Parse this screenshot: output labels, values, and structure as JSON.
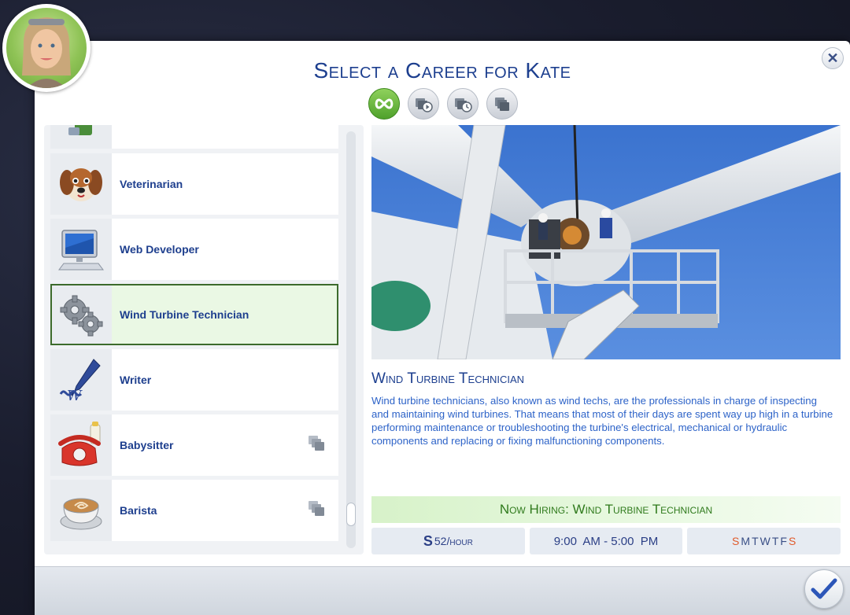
{
  "dialog": {
    "title": "Select a Career for Kate",
    "close_icon": "close-icon",
    "confirm_icon": "checkmark-icon"
  },
  "filters": [
    {
      "name": "all-careers",
      "icon": "infinity-icon",
      "active": true
    },
    {
      "name": "active-careers",
      "icon": "pack-play-icon",
      "active": false
    },
    {
      "name": "part-time-careers",
      "icon": "pack-clock-icon",
      "active": false
    },
    {
      "name": "pack-careers",
      "icon": "pack-icon",
      "active": false
    }
  ],
  "careers": [
    {
      "label": "",
      "icon": "career-icon-partial"
    },
    {
      "label": "Veterinarian",
      "icon": "dog-icon"
    },
    {
      "label": "Web Developer",
      "icon": "computer-icon"
    },
    {
      "label": "Wind Turbine Technician",
      "icon": "gears-icon",
      "selected": true
    },
    {
      "label": "Writer",
      "icon": "quill-pen-icon"
    },
    {
      "label": "Babysitter",
      "icon": "toy-phone-icon",
      "pack": true
    },
    {
      "label": "Barista",
      "icon": "latte-icon",
      "pack": true
    }
  ],
  "detail": {
    "title": "Wind Turbine Technician",
    "description": "Wind turbine technicians, also known as wind techs, are the professionals in charge of inspecting and maintaining wind turbines. That means that most of their days are spent way up high in a turbine performing maintenance or troubleshooting the turbine's electrical, mechanical or hydraulic components and replacing or fixing malfunctioning components.",
    "hiring": "Now Hiring: Wind Turbine Technician",
    "pay_symbol": "S",
    "pay": "52/hour",
    "hours": "9:00  AM - 5:00  PM",
    "days": [
      "S",
      "M",
      "T",
      "W",
      "T",
      "F",
      "S"
    ]
  },
  "colors": {
    "accent": "#1d3f8f",
    "hiring_green": "#2f7a1c",
    "weekend": "#e05a2b"
  }
}
